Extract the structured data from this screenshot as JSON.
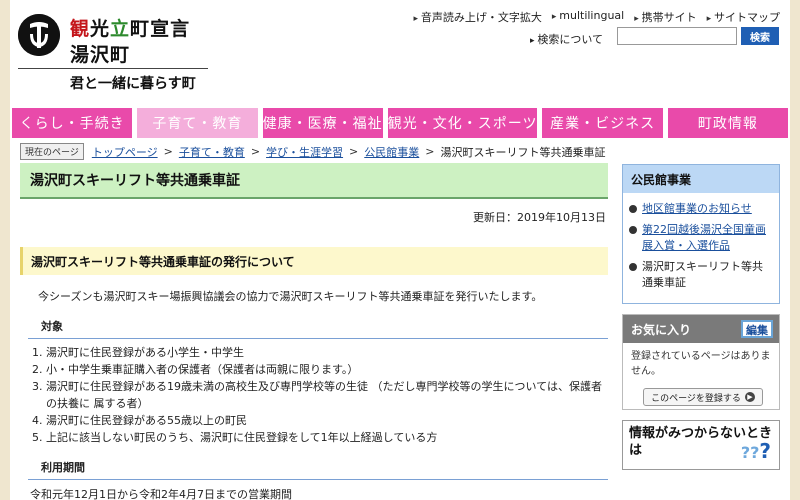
{
  "header": {
    "logo_chars": [
      {
        "ch": "観",
        "color": "red"
      },
      {
        "ch": "光",
        "color": "black"
      },
      {
        "ch": "立",
        "color": "green"
      },
      {
        "ch": "町",
        "color": "black"
      },
      {
        "ch": "宣",
        "color": "black"
      },
      {
        "ch": "言",
        "color": "black"
      }
    ],
    "logo_line2": "湯沢町",
    "tagline": "君と一緒に暮らす町",
    "util_links": [
      "音声読み上げ・文字拡大",
      "multilingual",
      "携帯サイト",
      "サイトマップ"
    ],
    "search_about": "検索について",
    "search_placeholder": "",
    "search_button": "検索"
  },
  "nav": {
    "items": [
      {
        "label": "くらし・手続き",
        "active": false
      },
      {
        "label": "子育て・教育",
        "active": true
      },
      {
        "label": "健康・医療・福祉",
        "active": false
      },
      {
        "label": "観光・文化・スポーツ",
        "active": false
      },
      {
        "label": "産業・ビジネス",
        "active": false
      },
      {
        "label": "町政情報",
        "active": false
      }
    ]
  },
  "breadcrumb": {
    "here_label": "現在のページ",
    "links": [
      "トップページ",
      "子育て・教育",
      "学び・生涯学習",
      "公民館事業"
    ],
    "current": "湯沢町スキーリフト等共通乗車証"
  },
  "main": {
    "title": "湯沢町スキーリフト等共通乗車証",
    "updated": "更新日：2019年10月13日",
    "section_title": "湯沢町スキーリフト等共通乗車証の発行について",
    "intro": "今シーズンも湯沢町スキー場振興協議会の協力で湯沢町スキーリフト等共通乗車証を発行いたします。",
    "taisho_heading": "対象",
    "taisho_items": [
      "湯沢町に住民登録がある小学生・中学生",
      "小・中学生乗車証購入者の保護者（保護者は両親に限ります。）",
      "湯沢町に住民登録がある19歳未満の高校生及び専門学校等の生徒 （ただし専門学校等の学生については、保護者の扶養に 属する者）",
      "湯沢町に住民登録がある55歳以上の町民",
      "上記に該当しない町民のうち、湯沢町に住民登録をして1年以上経過している方"
    ],
    "period_heading": "利用期間",
    "period_text": "令和元年12月1日から令和2年4月7日までの営業期間"
  },
  "sidebar": {
    "kominkan_title": "公民館事業",
    "kominkan_items": [
      {
        "label": "地区館事業のお知らせ",
        "link": true
      },
      {
        "label": "第22回越後湯沢全国童画展入賞・入選作品",
        "link": true
      },
      {
        "label": "湯沢町スキーリフト等共通乗車証",
        "link": false
      }
    ],
    "fav_title": "お気に入り",
    "fav_edit": "編集",
    "fav_text": "登録されているページはありません。",
    "fav_button": "このページを登録する",
    "help_text": "情報がみつからないときは"
  },
  "colors": {
    "nav_pink": "#e94aaa",
    "nav_active": "#f4aedb",
    "title_green": "#cdf1c2",
    "section_yellow": "#fdf8cc",
    "side_blue": "#bcd8f5",
    "link_blue": "#1a4f9c",
    "search_blue": "#1f5fb4"
  }
}
